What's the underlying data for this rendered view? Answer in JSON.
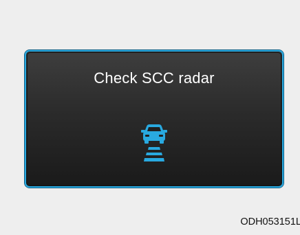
{
  "display": {
    "message": "Check SCC radar",
    "icon": "scc-radar-car-icon",
    "border_color": "#29a9e0",
    "icon_color": "#29a9e0"
  },
  "figure_code": "ODH053151L"
}
